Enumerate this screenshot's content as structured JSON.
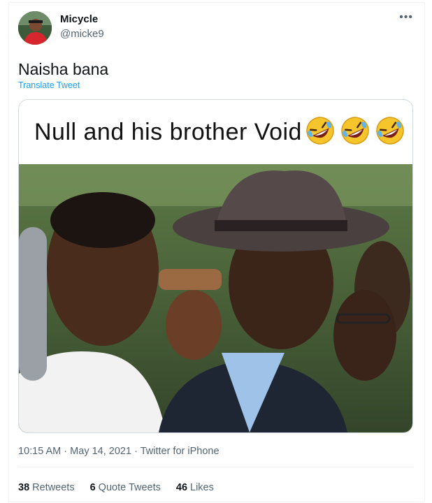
{
  "author": {
    "display_name": "Micycle",
    "handle": "@micke9"
  },
  "tweet": {
    "text": "Naisha bana",
    "translate_label": "Translate Tweet"
  },
  "media": {
    "caption": "Null and his brother Void",
    "emoji": [
      "rolling-on-floor-laughing",
      "rolling-on-floor-laughing",
      "rolling-on-floor-laughing"
    ]
  },
  "meta": {
    "time": "10:15 AM",
    "separator": "·",
    "date": "May 14, 2021",
    "source": "Twitter for iPhone"
  },
  "stats": {
    "retweets_count": "38",
    "retweets_label": "Retweets",
    "quotes_count": "6",
    "quotes_label": "Quote Tweets",
    "likes_count": "46",
    "likes_label": "Likes"
  },
  "colors": {
    "link": "#1d9bf0",
    "secondary_text": "#536471",
    "primary_text": "#0f1419"
  }
}
